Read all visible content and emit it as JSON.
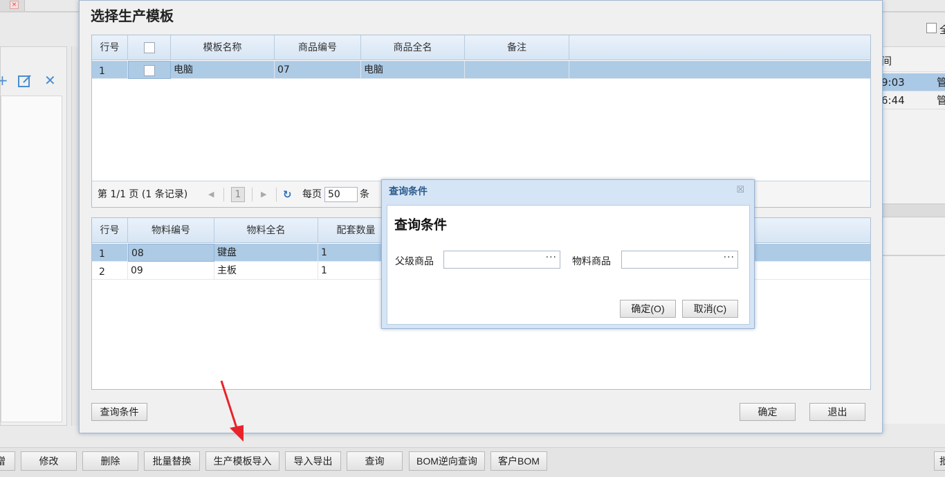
{
  "background": {
    "tab_close": "×",
    "toolbar_icons": [
      "add-icon",
      "edit-icon",
      "close-icon"
    ],
    "top_checkbox_label": "全",
    "right_header": "间",
    "right_header2": "",
    "right_rows": [
      {
        "time": "9:03",
        "user": "管"
      },
      {
        "time": "6:44",
        "user": "管"
      }
    ],
    "bottom_buttons": [
      "增",
      "修改",
      "删除",
      "批量替换",
      "生产模板导入",
      "导入导出",
      "查询",
      "BOM逆向查询",
      "客户BOM",
      "批"
    ]
  },
  "dialog": {
    "title": "选择生产模板",
    "top_grid": {
      "columns": [
        "行号",
        "",
        "模板名称",
        "商品编号",
        "商品全名",
        "备注"
      ],
      "rows": [
        {
          "line": "1",
          "template_name": "电脑",
          "product_code": "07",
          "product_name": "电脑",
          "note": ""
        }
      ]
    },
    "pager": {
      "summary": "第 1/1 页 (1 条记录)",
      "page": "1",
      "per_page_label": "每页",
      "per_page": "50",
      "unit": "条"
    },
    "bottom_grid": {
      "columns": [
        "行号",
        "物料编号",
        "物料全名",
        "配套数量"
      ],
      "rows": [
        {
          "line": "1",
          "code": "08",
          "name": "键盘",
          "qty": "1"
        },
        {
          "line": "2",
          "code": "09",
          "name": "主板",
          "qty": "1"
        }
      ]
    },
    "query_button": "查询条件",
    "ok_button": "确定",
    "exit_button": "退出"
  },
  "query_dialog": {
    "title": "查询条件",
    "heading": "查询条件",
    "parent_label": "父级商品",
    "parent_value": "",
    "material_label": "物料商品",
    "material_value": "",
    "browse": "···",
    "ok_button": "确定(O)",
    "cancel_button": "取消(C)",
    "close_glyph": "☒"
  },
  "colors": {
    "selected_row": "#aecbe6",
    "header_bg": "#d7e5f4",
    "annotation_arrow": "#e8232a"
  }
}
